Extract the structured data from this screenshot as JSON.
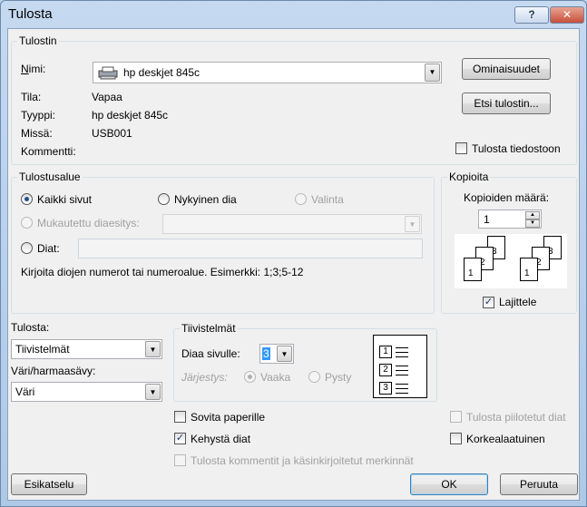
{
  "window": {
    "title": "Tulosta",
    "help": "?",
    "close": "✕"
  },
  "printer": {
    "group_title": "Tulostin",
    "name_label": "Nimi:",
    "name_value": "hp deskjet 845c",
    "status_label": "Tila:",
    "status_value": "Vapaa",
    "type_label": "Tyyppi:",
    "type_value": "hp deskjet 845c",
    "where_label": "Missä:",
    "where_value": "USB001",
    "comment_label": "Kommentti:",
    "properties_button": "Ominaisuudet",
    "find_button": "Etsi tulostin...",
    "print_to_file": "Tulosta tiedostoon"
  },
  "range": {
    "group_title": "Tulostusalue",
    "all": "Kaikki sivut",
    "current": "Nykyinen dia",
    "selection": "Valinta",
    "custom_show": "Mukautettu diaesitys:",
    "slides": "Diat:",
    "hint": "Kirjoita diojen numerot tai numeroalue. Esimerkki: 1;3;5-12"
  },
  "copies": {
    "group_title": "Kopioita",
    "count_label": "Kopioiden määrä:",
    "count_value": "1",
    "collate": "Lajittele",
    "collate_checked": true
  },
  "print_what": {
    "label": "Tulosta:",
    "value": "Tiivistelmät"
  },
  "color": {
    "label": "Väri/harmaasävy:",
    "value": "Väri"
  },
  "handouts": {
    "group_title": "Tiivistelmät",
    "per_page_label": "Diaa sivulle:",
    "per_page_value": "3",
    "order_label": "Järjestys:",
    "horizontal": "Vaaka",
    "vertical": "Pysty",
    "preview_rows": [
      "1",
      "2",
      "3"
    ]
  },
  "options": {
    "fit": "Sovita paperille",
    "frame": "Kehystä diat",
    "comments": "Tulosta kommentit ja käsinkirjoitetut merkinnät",
    "hidden": "Tulosta piilotetut diat",
    "hq": "Korkealaatuinen"
  },
  "footer": {
    "preview": "Esikatselu",
    "ok": "OK",
    "cancel": "Peruuta"
  }
}
